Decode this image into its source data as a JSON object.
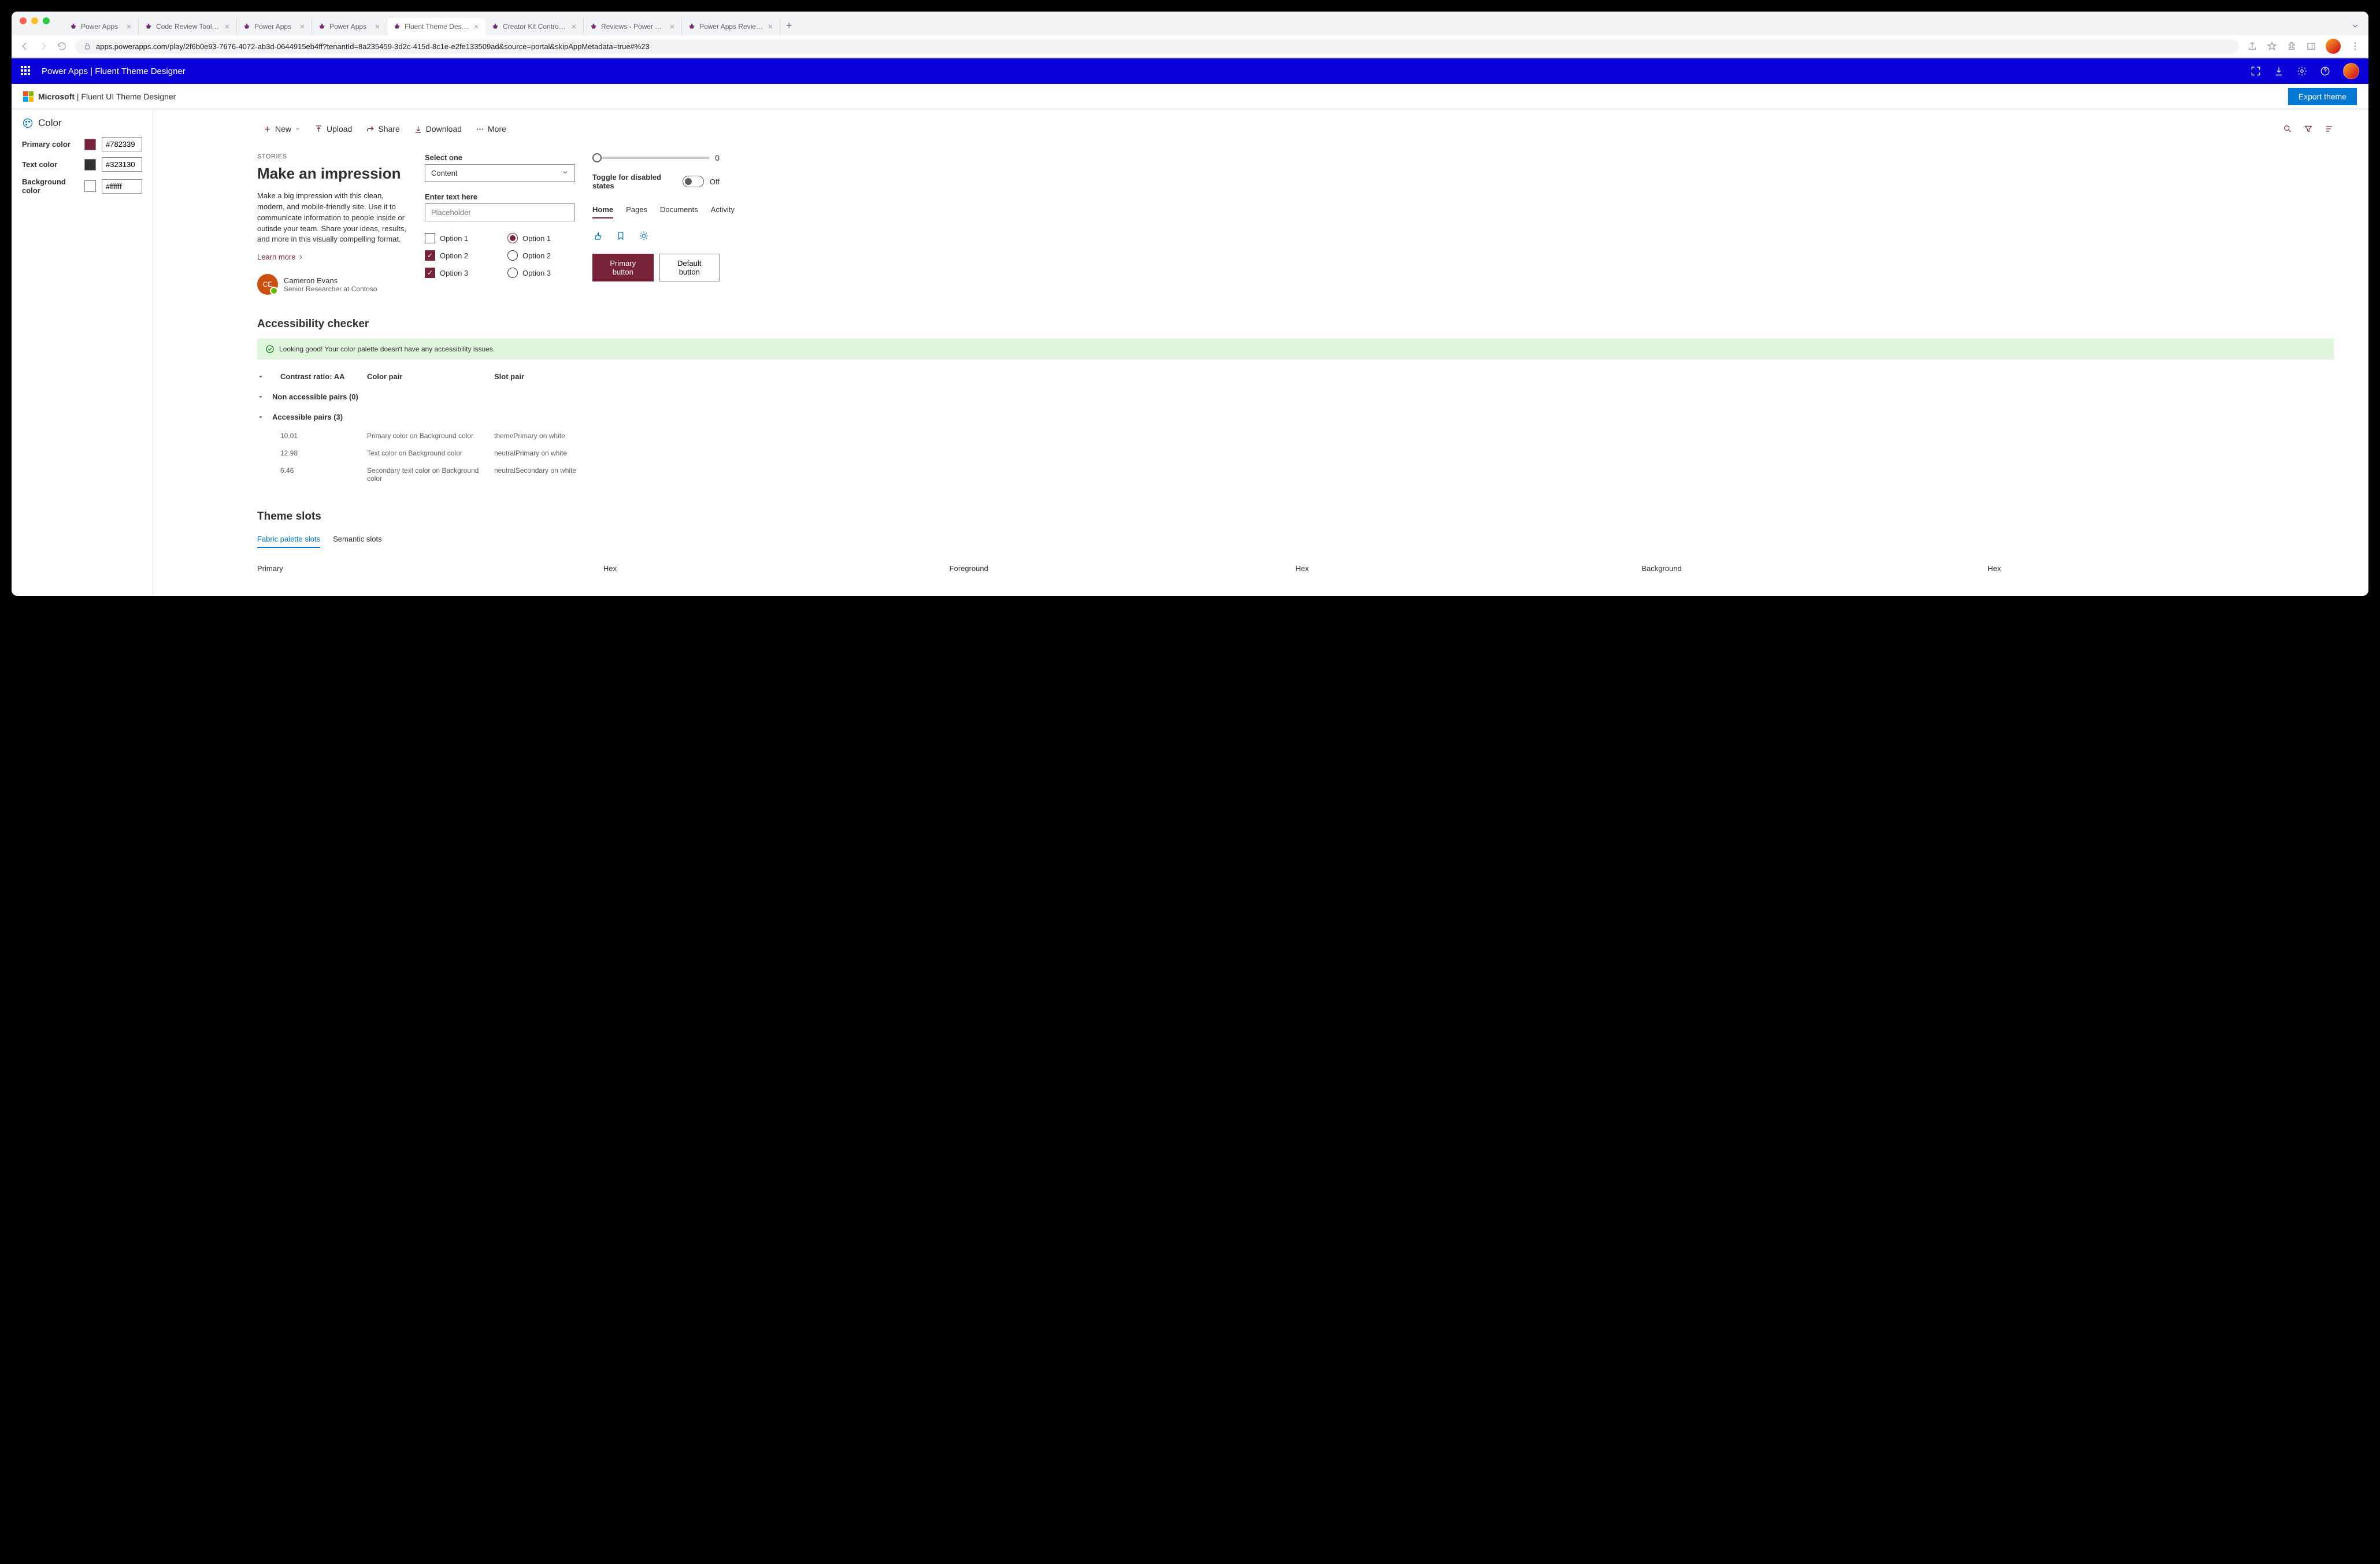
{
  "browser": {
    "tabs": [
      {
        "title": "Power Apps",
        "active": false
      },
      {
        "title": "Code Review Tool Experim",
        "active": false
      },
      {
        "title": "Power Apps",
        "active": false
      },
      {
        "title": "Power Apps",
        "active": false
      },
      {
        "title": "Fluent Theme Designer - P",
        "active": true
      },
      {
        "title": "Creator Kit Control Referen",
        "active": false
      },
      {
        "title": "Reviews - Power Apps",
        "active": false
      },
      {
        "title": "Power Apps Review Tool -",
        "active": false
      }
    ],
    "url": "apps.powerapps.com/play/2f6b0e93-7676-4072-ab3d-0644915eb4ff?tenantId=8a235459-3d2c-415d-8c1e-e2fe133509ad&source=portal&skipAppMetadata=true#%23"
  },
  "appbar": {
    "title": "Power Apps  |  Fluent Theme Designer"
  },
  "subbar": {
    "brand": "Microsoft",
    "product": " | Fluent UI Theme Designer",
    "export": "Export theme"
  },
  "sidebar": {
    "heading": "Color",
    "rows": [
      {
        "label": "Primary color",
        "swatch": "#782339",
        "value": "#782339"
      },
      {
        "label": "Text color",
        "swatch": "#323130",
        "value": "#323130"
      },
      {
        "label": "Background color",
        "swatch": "#ffffff",
        "value": "#ffffff"
      }
    ]
  },
  "cmd": {
    "items": [
      {
        "label": "New",
        "icon": "plus",
        "split": true
      },
      {
        "label": "Upload",
        "icon": "upload"
      },
      {
        "label": "Share",
        "icon": "share"
      },
      {
        "label": "Download",
        "icon": "download"
      },
      {
        "label": "More",
        "icon": "more"
      }
    ]
  },
  "story": {
    "eyebrow": "STORIES",
    "title": "Make an impression",
    "body": "Make a big impression with this clean, modern, and mobile-friendly site. Use it to communicate information to people inside or outisde your team. Share your ideas, results, and more in this visually compelling format.",
    "learn": "Learn more",
    "persona": {
      "initials": "CE",
      "name": "Cameron Evans",
      "secondary": "Senior Researcher at Contoso"
    }
  },
  "form": {
    "select_label": "Select one",
    "select_value": "Content",
    "text_label": "Enter text here",
    "text_placeholder": "Placeholder",
    "checks": [
      {
        "label": "Option 1",
        "checked": false
      },
      {
        "label": "Option 2",
        "checked": true
      },
      {
        "label": "Option 3",
        "checked": true
      }
    ],
    "radios": [
      {
        "label": "Option 1",
        "checked": true
      },
      {
        "label": "Option 2",
        "checked": false
      },
      {
        "label": "Option 3",
        "checked": false
      }
    ]
  },
  "right": {
    "slider_value": "0",
    "toggle_label": "Toggle for disabled states",
    "toggle_state": "Off",
    "pivots": [
      "Home",
      "Pages",
      "Documents",
      "Activity"
    ],
    "primary_btn": "Primary button",
    "default_btn": "Default button"
  },
  "a11y": {
    "heading": "Accessibility checker",
    "banner": "Looking good! Your color palette doesn't have any accessibility issues.",
    "cols": {
      "ratio": "Contrast ratio: AA",
      "pair": "Color pair",
      "slot": "Slot pair"
    },
    "group_non": "Non accessible pairs (0)",
    "group_acc": "Accessible pairs (3)",
    "rows": [
      {
        "ratio": "10.01",
        "pair": "Primary color on Background color",
        "slot": "themePrimary on white"
      },
      {
        "ratio": "12.98",
        "pair": "Text color on Background color",
        "slot": "neutralPrimary on white"
      },
      {
        "ratio": "6.46",
        "pair": "Secondary text color on Background color",
        "slot": "neutralSecondary on white"
      }
    ]
  },
  "slots": {
    "heading": "Theme slots",
    "pivots": [
      "Fabric palette slots",
      "Semantic slots"
    ],
    "cols": [
      "Primary",
      "Hex",
      "Foreground",
      "Hex",
      "Background",
      "Hex"
    ]
  }
}
